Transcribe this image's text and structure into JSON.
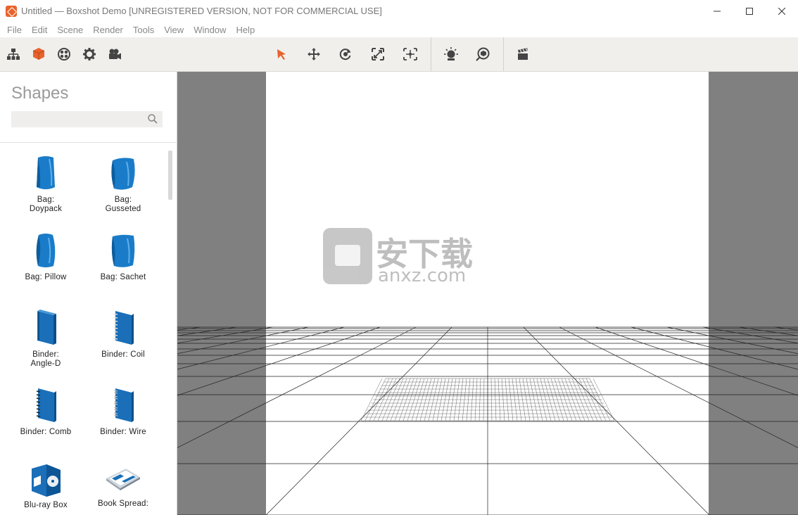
{
  "window": {
    "title": "Untitled — Boxshot Demo [UNREGISTERED VERSION, NOT FOR COMMERCIAL USE]",
    "minimize_glyph": "—",
    "maximize_glyph": "☐",
    "close_glyph": "✕"
  },
  "menu": [
    "File",
    "Edit",
    "Scene",
    "Render",
    "Tools",
    "View",
    "Window",
    "Help"
  ],
  "toolbar": {
    "left_tools": [
      "scene-tree-icon",
      "shapes-icon",
      "materials-icon",
      "settings-icon",
      "camera-icon"
    ],
    "center_tools": [
      "select-arrow-icon",
      "move-icon",
      "rotate-icon",
      "scale-icon",
      "snap-icon"
    ],
    "right_tools": [
      "light-icon",
      "render-preview-icon",
      "clapperboard-icon"
    ],
    "accent_color": "#e8632c"
  },
  "sidebar": {
    "title": "Shapes",
    "search_placeholder": "",
    "shapes": [
      {
        "label": "Bag:\nDoypack",
        "icon": "bag-doypack-icon"
      },
      {
        "label": "Bag:\nGusseted",
        "icon": "bag-gusseted-icon"
      },
      {
        "label": "Bag: Pillow",
        "icon": "bag-pillow-icon"
      },
      {
        "label": "Bag: Sachet",
        "icon": "bag-sachet-icon"
      },
      {
        "label": "Binder:\nAngle-D",
        "icon": "binder-angle-d-icon"
      },
      {
        "label": "Binder: Coil",
        "icon": "binder-coil-icon"
      },
      {
        "label": "Binder: Comb",
        "icon": "binder-comb-icon"
      },
      {
        "label": "Binder: Wire",
        "icon": "binder-wire-icon"
      },
      {
        "label": "Blu-ray Box",
        "icon": "bluray-box-icon"
      },
      {
        "label": "Book Spread:",
        "icon": "book-spread-icon"
      }
    ]
  },
  "viewport": {
    "watermark_text": "安下载",
    "watermark_sub": "anxz.com",
    "background_color": "#808080",
    "canvas_color": "#ffffff"
  }
}
